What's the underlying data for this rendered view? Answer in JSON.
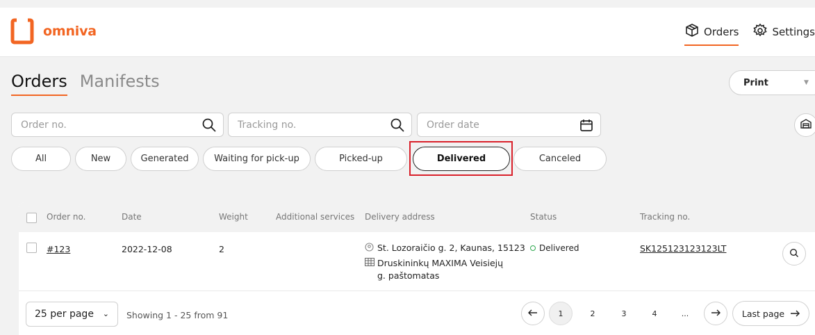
{
  "brand": {
    "name": "omniva",
    "accent": "#f26522"
  },
  "nav": {
    "orders": "Orders",
    "settings": "Settings"
  },
  "tabs": [
    "Orders",
    "Manifests"
  ],
  "print": {
    "label": "Print"
  },
  "filters": {
    "order_no": {
      "placeholder": "Order no."
    },
    "tracking_no": {
      "placeholder": "Tracking no."
    },
    "order_date": {
      "placeholder": "Order date"
    }
  },
  "status_filters": [
    "All",
    "New",
    "Generated",
    "Waiting for pick-up",
    "Picked-up",
    "Delivered",
    "Canceled"
  ],
  "active_status_filter": "Delivered",
  "highlight_color": "#d9202a",
  "table": {
    "columns": [
      "Order no.",
      "Date",
      "Weight",
      "Additional services",
      "Delivery address",
      "Status",
      "Tracking no."
    ],
    "rows": [
      {
        "order_no": "#123",
        "date": "2022-12-08",
        "weight": "2",
        "additional_services": "",
        "address_line": "St. Lozoraičio g. 2, Kaunas, 15123",
        "terminal_line1": "Druskininkų MAXIMA Veisiejų",
        "terminal_line2": "g. paštomatas",
        "status": "Delivered",
        "status_color": "#2fa84f",
        "tracking_no": "SK125123123123LT"
      }
    ]
  },
  "pagination": {
    "per_page": "25 per page",
    "showing": "Showing 1 - 25 from 91",
    "pages": [
      "1",
      "2",
      "3",
      "4",
      "..."
    ],
    "current_page": "1",
    "last_page": "Last page"
  }
}
